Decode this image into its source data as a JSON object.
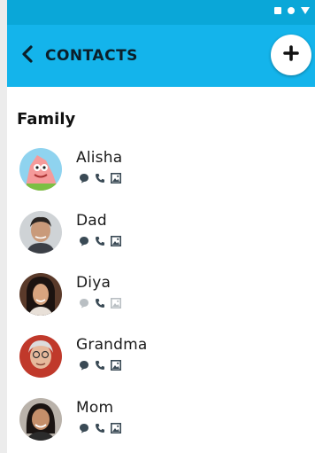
{
  "header": {
    "title": "CONTACTS"
  },
  "section": {
    "title": "Family"
  },
  "contacts": [
    {
      "name": "Alisha"
    },
    {
      "name": "Dad"
    },
    {
      "name": "Diya"
    },
    {
      "name": "Grandma"
    },
    {
      "name": "Mom"
    }
  ],
  "icons": {
    "back": "chevron-left-icon",
    "add": "plus-icon",
    "message": "message-icon",
    "call": "phone-icon",
    "photo": "image-icon"
  },
  "colors": {
    "status_bar": "#0aa7d8",
    "app_bar": "#14b4eb",
    "title_text": "#0b1f2a",
    "icon_gray": "#3a4a55"
  }
}
